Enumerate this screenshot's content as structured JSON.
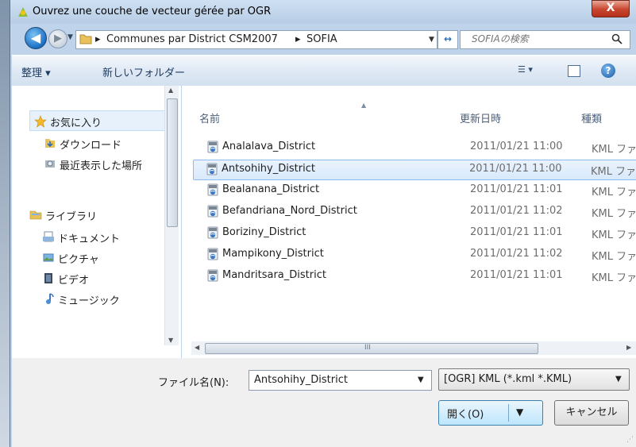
{
  "window": {
    "title": "Ouvrez une couche de vecteur gérée par OGR",
    "close_label": "X"
  },
  "address": {
    "crumbs": [
      "Communes par District CSM2007",
      "SOFIA"
    ],
    "separator": "▸",
    "search_placeholder": "SOFIAの検索"
  },
  "toolbar": {
    "organize_label": "整理 ▾",
    "new_folder_label": "新しいフォルダー",
    "help_label": "?"
  },
  "nav": {
    "items": [
      {
        "label": "お気に入り",
        "icon": "star-icon"
      },
      {
        "label": "ダウンロード",
        "icon": "downloads-folder-icon"
      },
      {
        "label": "最近表示した場所",
        "icon": "recent-places-icon"
      },
      {
        "label": "ライブラリ",
        "icon": "library-icon"
      },
      {
        "label": "ドキュメント",
        "icon": "documents-icon"
      },
      {
        "label": "ピクチャ",
        "icon": "pictures-icon"
      },
      {
        "label": "ビデオ",
        "icon": "videos-icon"
      },
      {
        "label": "ミュージック",
        "icon": "music-icon"
      }
    ]
  },
  "files": {
    "columns": {
      "name": "名前",
      "date": "更新日時",
      "type": "種類"
    },
    "rows": [
      {
        "name": "Analalava_District",
        "date": "2011/01/21 11:00",
        "type": "KML ファイ"
      },
      {
        "name": "Antsohihy_District",
        "date": "2011/01/21 11:00",
        "type": "KML ファイ",
        "selected": true
      },
      {
        "name": "Bealanana_District",
        "date": "2011/01/21 11:01",
        "type": "KML ファイ"
      },
      {
        "name": "Befandriana_Nord_District",
        "date": "2011/01/21 11:02",
        "type": "KML ファイ"
      },
      {
        "name": "Boriziny_District",
        "date": "2011/01/21 11:01",
        "type": "KML ファイ"
      },
      {
        "name": "Mampikony_District",
        "date": "2011/01/21 11:02",
        "type": "KML ファイ"
      },
      {
        "name": "Mandritsara_District",
        "date": "2011/01/21 11:01",
        "type": "KML ファイ"
      }
    ],
    "hscroll_grip": "III"
  },
  "footer": {
    "filename_label": "ファイル名(N):",
    "filename_value": "Antsohihy_District",
    "filter_value": "[OGR] KML (*.kml *.KML)",
    "open_label": "開く(O)",
    "cancel_label": "キャンセル"
  },
  "colors": {
    "accent": "#1b6fc4",
    "selection": "#d8e9fb",
    "close": "#c8452e"
  }
}
